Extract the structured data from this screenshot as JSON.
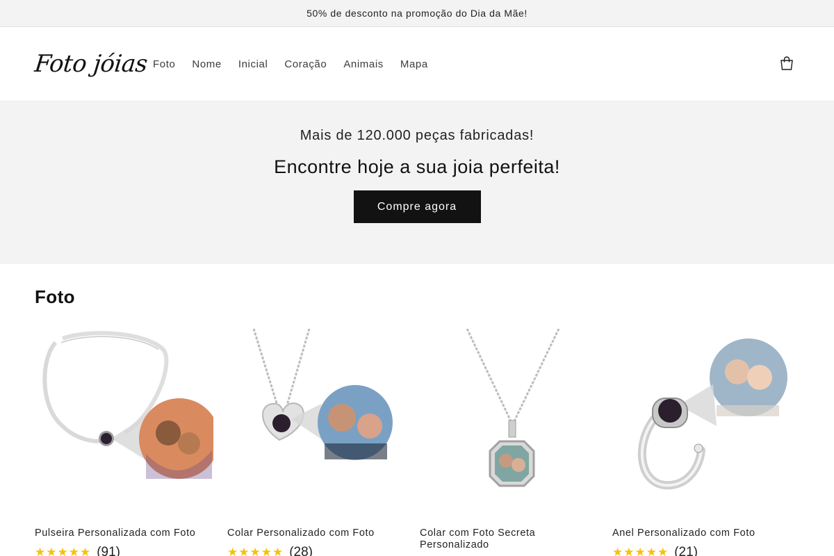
{
  "announcement": {
    "text": "50% de desconto na promoção do Dia da Mãe!"
  },
  "header": {
    "logo_text": "Foto jóias",
    "nav": [
      "Foto",
      "Nome",
      "Inicial",
      "Coração",
      "Animais",
      "Mapa"
    ],
    "cart_icon": "cart-bag-icon"
  },
  "hero": {
    "subtitle": "Mais de 120.000 peças fabricadas!",
    "title": "Encontre hoje a sua joia perfeita!",
    "button_label": "Compre agora"
  },
  "section": {
    "title": "Foto",
    "products": [
      {
        "title": "Pulseira Personalizada com Foto",
        "stars": "★★★★★",
        "reviews": "(91)"
      },
      {
        "title": "Colar Personalizado com Foto",
        "stars": "★★★★★",
        "reviews": "(28)"
      },
      {
        "title": "Colar com Foto Secreta Personalizado",
        "stars": "",
        "reviews": ""
      },
      {
        "title": "Anel Personalizado com Foto",
        "stars": "★★★★★",
        "reviews": "(21)"
      }
    ]
  },
  "colors": {
    "star": "#f4c20d",
    "button_bg": "#121212",
    "hero_bg": "#f3f3f3"
  }
}
